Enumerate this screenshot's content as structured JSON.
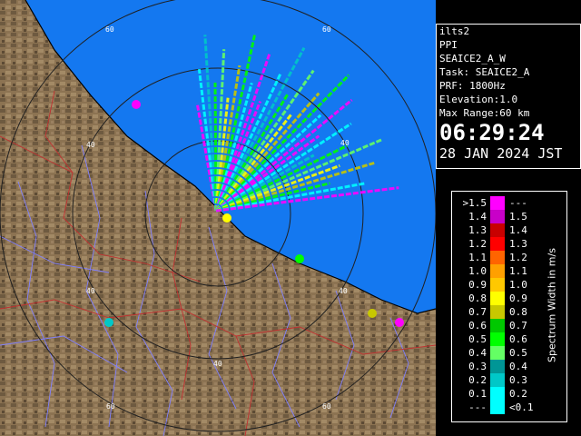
{
  "map": {
    "range_labels": [
      "60",
      "60",
      "40",
      "40",
      "40",
      "40",
      "40",
      "60",
      "60"
    ],
    "colors": {
      "sea": "#1478f0",
      "land": "#8c7352",
      "ring": "#282828",
      "river": "#7a7aff",
      "boundary": "#c03030",
      "coast": "#000000"
    }
  },
  "info": {
    "site": "ilts2",
    "product": "PPI",
    "scan": "SEAICE2_A_W",
    "task": "Task: SEAICE2_A",
    "prf": "PRF: 1800Hz",
    "elevation": "Elevation:1.0",
    "max_range": "Max Range:60 km",
    "time": "06:29:24",
    "date": "28 JAN 2024 JST"
  },
  "legend": {
    "title": "Spectrum Width in m/s",
    "rows": [
      {
        "left": ">1.5",
        "right": "---",
        "color": "#ff00ff"
      },
      {
        "left": "1.4",
        "right": "1.5",
        "color": "#c800c8"
      },
      {
        "left": "1.3",
        "right": "1.4",
        "color": "#c80000"
      },
      {
        "left": "1.2",
        "right": "1.3",
        "color": "#ff0000"
      },
      {
        "left": "1.1",
        "right": "1.2",
        "color": "#ff6400"
      },
      {
        "left": "1.0",
        "right": "1.1",
        "color": "#ffa000"
      },
      {
        "left": "0.9",
        "right": "1.0",
        "color": "#ffc800"
      },
      {
        "left": "0.8",
        "right": "0.9",
        "color": "#ffff00"
      },
      {
        "left": "0.7",
        "right": "0.8",
        "color": "#c8c800"
      },
      {
        "left": "0.6",
        "right": "0.7",
        "color": "#00c800"
      },
      {
        "left": "0.5",
        "right": "0.6",
        "color": "#00ff00"
      },
      {
        "left": "0.4",
        "right": "0.5",
        "color": "#64ff64"
      },
      {
        "left": "0.3",
        "right": "0.4",
        "color": "#009696"
      },
      {
        "left": "0.2",
        "right": "0.3",
        "color": "#00c8c8"
      },
      {
        "left": "0.1",
        "right": "0.2",
        "color": "#00ffff"
      },
      {
        "left": "---",
        "right": "<0.1",
        "color": "#00ffff"
      }
    ]
  }
}
